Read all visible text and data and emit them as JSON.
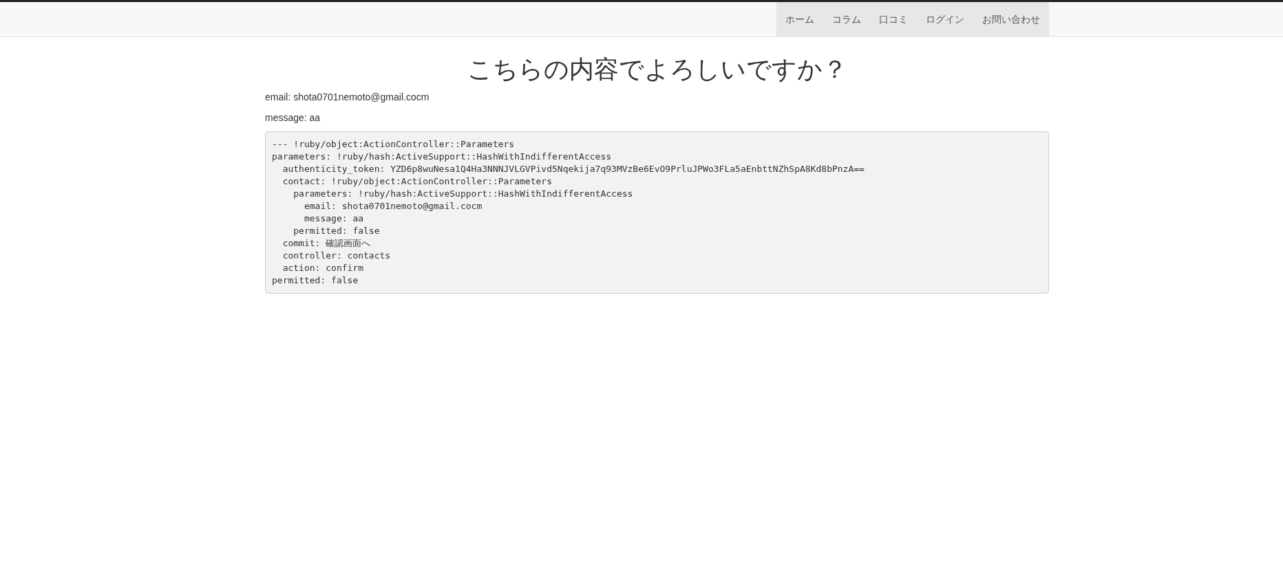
{
  "navbar": {
    "links": [
      "ホーム",
      "コラム",
      "口コミ",
      "ログイン",
      "お問い合わせ"
    ]
  },
  "heading": "こちらの内容でよろしいですか？",
  "fields": [
    "email: shota0701nemoto@gmail.cocm",
    "message: aa"
  ],
  "debug_output": {
    "lines": [
      {
        "text": "--- !ruby/object:ActionController::Parameters"
      },
      {
        "text": "parameters: !ruby/hash:ActiveSupport::HashWithIndifferentAccess",
        "children": [
          {
            "text": "authenticity_token: YZD6p8wuNesa1Q4Ha3NNNJVLGVPivd5Nqekija7q93MVzBe6EvO9PrluJPWo3FLa5aEnbttNZhSpA8Kd8bPnzA=="
          },
          {
            "text": "contact: !ruby/object:ActionController::Parameters",
            "children": [
              {
                "text": "parameters: !ruby/hash:ActiveSupport::HashWithIndifferentAccess",
                "children": [
                  {
                    "text": "email: shota0701nemoto@gmail.cocm"
                  },
                  {
                    "text": "message: aa"
                  }
                ]
              },
              {
                "text": "permitted: false"
              }
            ]
          },
          {
            "text": "commit: 確認画面へ"
          },
          {
            "text": "controller: contacts"
          },
          {
            "text": "action: confirm"
          }
        ]
      },
      {
        "text": "permitted: false"
      }
    ]
  }
}
